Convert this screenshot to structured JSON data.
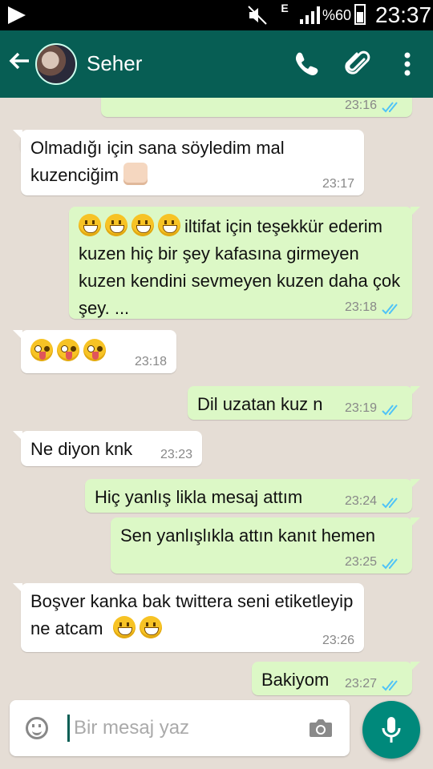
{
  "status_bar": {
    "battery_percent": "%60",
    "time": "23:37",
    "network": "E"
  },
  "header": {
    "contact_name": "Seher"
  },
  "messages": [
    {
      "dir": "out",
      "text": "",
      "time": "23:16"
    },
    {
      "dir": "in",
      "text": "Olmadığı için sana söyledim mal kuzenciğim",
      "time": "23:17"
    },
    {
      "dir": "out",
      "text": "iltifat için teşekkür ederim  kuzen hiç bir şey  kafasına girmeyen  kuzen kendini sevmeyen kuzen  daha çok şey. ...",
      "time": "23:18"
    },
    {
      "dir": "in",
      "text": "",
      "time": "23:18"
    },
    {
      "dir": "out",
      "text": "Dil uzatan kuz n",
      "time": "23:19"
    },
    {
      "dir": "in",
      "text": "Ne diyon knk",
      "time": "23:23"
    },
    {
      "dir": "out",
      "text": "Hiç  yanlış likla  mesaj attım",
      "time": "23:24"
    },
    {
      "dir": "out",
      "text": "Sen yanlışlıkla attın kanıt hemen",
      "time": "23:25"
    },
    {
      "dir": "in",
      "text": "Boşver kanka bak twittera seni etiketleyip ne atcam",
      "time": "23:26"
    },
    {
      "dir": "out",
      "text": "Bakiyom",
      "time": "23:27"
    }
  ],
  "composer": {
    "placeholder": "Bir mesaj yaz"
  },
  "colors": {
    "header": "#075e54",
    "outgoing_bubble": "#dcf8c6",
    "incoming_bubble": "#ffffff",
    "chat_background": "#e5ddd5",
    "read_ticks": "#4fc3f7",
    "mic_button": "#00897b"
  }
}
